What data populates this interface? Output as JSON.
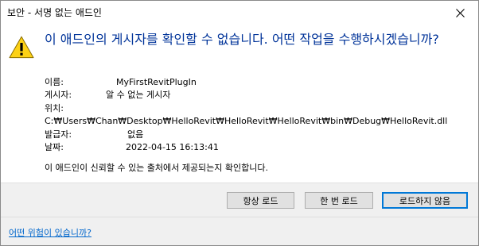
{
  "window": {
    "title": "보안 - 서명 없는 애드인",
    "close_glyph": "✕"
  },
  "message": {
    "heading": "이 애드인의 게시자를 확인할 수 없습니다. 어떤 작업을 수행하시겠습니까?",
    "icon": "warning-icon"
  },
  "details": {
    "name_label": "이름:",
    "name_value": "MyFirstRevitPlugIn",
    "publisher_label": "게시자:",
    "publisher_value": "알 수 없는 게시자",
    "location_label": "위치:",
    "location_value": "C:₩Users₩Chan₩Desktop₩HelloRevit₩HelloRevit₩HelloRevit₩bin₩Debug₩HelloRevit.dll",
    "issuer_label": "발급자:",
    "issuer_value": "없음",
    "date_label": "날짜:",
    "date_value": "2022-04-15 16:13:41"
  },
  "verify_message": "이 애드인이 신뢰할 수 있는 출처에서 제공되는지 확인합니다.",
  "buttons": {
    "always_load": "항상 로드",
    "load_once": "한 번 로드",
    "do_not_load": "로드하지 않음"
  },
  "footer": {
    "risk_link": "어떤 위험이 있습니까?"
  },
  "colors": {
    "heading": "#003399",
    "link": "#0066cc",
    "default_button_border": "#0078d7",
    "warning_fill": "#fcd116",
    "button_bar": "#f0f0f0"
  }
}
